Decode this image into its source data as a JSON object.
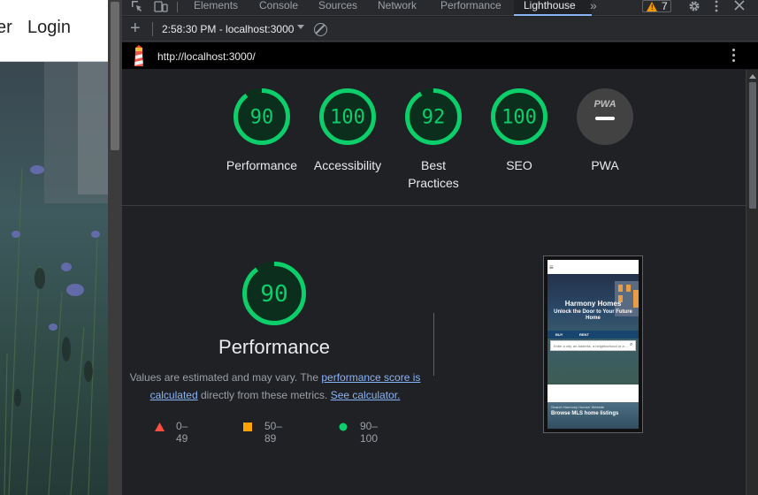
{
  "page": {
    "nav_partial": "er",
    "nav_login": "Login"
  },
  "devtools": {
    "tabs": [
      "Elements",
      "Console",
      "Sources",
      "Network",
      "Performance",
      "Lighthouse"
    ],
    "active_tab": "Lighthouse",
    "warning_count": "7",
    "toolbar": {
      "report_label": "2:58:30 PM - localhost:3000"
    },
    "url": "http://localhost:3000/"
  },
  "lighthouse": {
    "scores": [
      {
        "label": "Performance",
        "score": "90",
        "value": 90
      },
      {
        "label": "Accessibility",
        "score": "100",
        "value": 100
      },
      {
        "label": "Best Practices",
        "score": "92",
        "value": 92
      },
      {
        "label": "SEO",
        "score": "100",
        "value": 100
      },
      {
        "label": "PWA",
        "score": "PWA"
      }
    ],
    "performance": {
      "score": "90",
      "value": 90,
      "title": "Performance",
      "desc_prefix": "Values are estimated and may vary. The ",
      "desc_link": "performance score is calculated",
      "desc_mid": " directly from these metrics. ",
      "desc_link2": "See calculator."
    },
    "legend": [
      {
        "range": "0–49",
        "color": "#ff4e42"
      },
      {
        "range": "50–89",
        "color": "#ffa400"
      },
      {
        "range": "90–100",
        "color": "#0cce6b"
      }
    ],
    "colors": {
      "pass": "#0cce6b",
      "pass_text": "#0cce6b",
      "pass_bg": "#0b2e1d",
      "pwa_bg": "#424242"
    },
    "screenshot": {
      "title": "Harmony Homes",
      "subtitle": "Unlock the Door to Your Future Home",
      "tab_buy": "BUY",
      "tab_rent": "RENT",
      "search_placeholder": "Enter a city, an address, a neighborhood or a ...",
      "small_text": "Search Harmony Homes' Website",
      "browse": "Browse MLS home listings"
    }
  }
}
